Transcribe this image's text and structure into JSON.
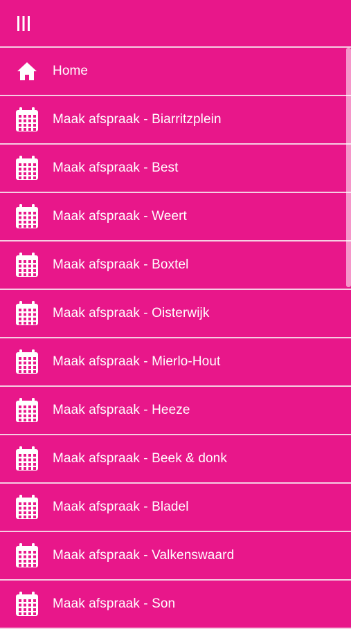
{
  "topbar": {
    "menu_icon": "hamburger-menu-icon"
  },
  "colors": {
    "background": "#e8178a",
    "divider": "#f6cde3",
    "text": "#ffffff"
  },
  "menu": {
    "items": [
      {
        "label": "Home",
        "icon": "home-icon"
      },
      {
        "label": "Maak afspraak - Biarritzplein",
        "icon": "calendar-icon"
      },
      {
        "label": "Maak afspraak - Best",
        "icon": "calendar-icon"
      },
      {
        "label": "Maak afspraak - Weert",
        "icon": "calendar-icon"
      },
      {
        "label": "Maak afspraak - Boxtel",
        "icon": "calendar-icon"
      },
      {
        "label": "Maak afspraak - Oisterwijk",
        "icon": "calendar-icon"
      },
      {
        "label": "Maak afspraak - Mierlo-Hout",
        "icon": "calendar-icon"
      },
      {
        "label": "Maak afspraak - Heeze",
        "icon": "calendar-icon"
      },
      {
        "label": "Maak afspraak - Beek & donk",
        "icon": "calendar-icon"
      },
      {
        "label": "Maak afspraak - Bladel",
        "icon": "calendar-icon"
      },
      {
        "label": "Maak afspraak - Valkenswaard",
        "icon": "calendar-icon"
      },
      {
        "label": "Maak afspraak - Son",
        "icon": "calendar-icon"
      }
    ]
  }
}
